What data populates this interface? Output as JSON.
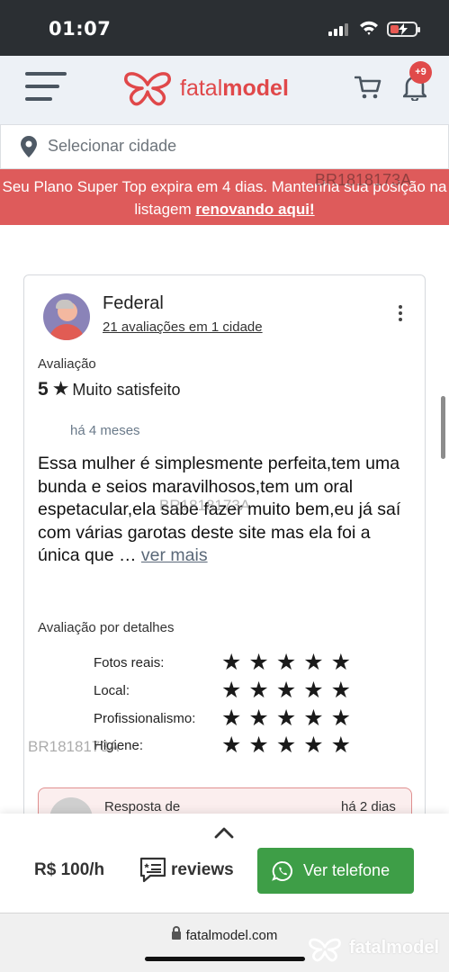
{
  "status_bar": {
    "time": "01:07"
  },
  "header": {
    "brand_light": "fatal",
    "brand_bold": "model",
    "notification_count": "+9"
  },
  "city_select": {
    "placeholder": "Selecionar cidade"
  },
  "banner": {
    "text": "Seu Plano Super Top expira em 4 dias. Mantenha sua posição na listagem ",
    "link": "renovando aqui!"
  },
  "watermark": "BR1818173A",
  "review": {
    "author": "Federal",
    "author_stats": "21 avaliações em 1 cidade",
    "rating_label": "Avaliação",
    "rating_value": "5",
    "rating_text": "Muito satisfeito",
    "date": "há 4 meses",
    "body": "Essa mulher é simplesmente perfeita,tem uma bunda e seios maravilhosos,tem um oral espetacular,ela sabe fazer muito bem,eu já saí com várias garotas deste site mas ela foi a única que … ",
    "see_more": "ver mais",
    "details_label": "Avaliação por detalhes",
    "details": [
      {
        "label": "Fotos reais:",
        "stars": 5
      },
      {
        "label": "Local:",
        "stars": 5
      },
      {
        "label": "Profissionalismo:",
        "stars": 5
      },
      {
        "label": "Higiene:",
        "stars": 5
      }
    ],
    "reply": {
      "label": "Resposta de",
      "date": "há 2 dias"
    }
  },
  "action_bar": {
    "price": "R$ 100/h",
    "reviews_label": "reviews",
    "call_label": "Ver telefone"
  },
  "browser": {
    "url": "fatalmodel.com",
    "watermark_brand": "fatalmodel"
  },
  "colors": {
    "brand": "#e0484a",
    "banner": "#de5b5b",
    "call_button": "#3e9e47"
  }
}
